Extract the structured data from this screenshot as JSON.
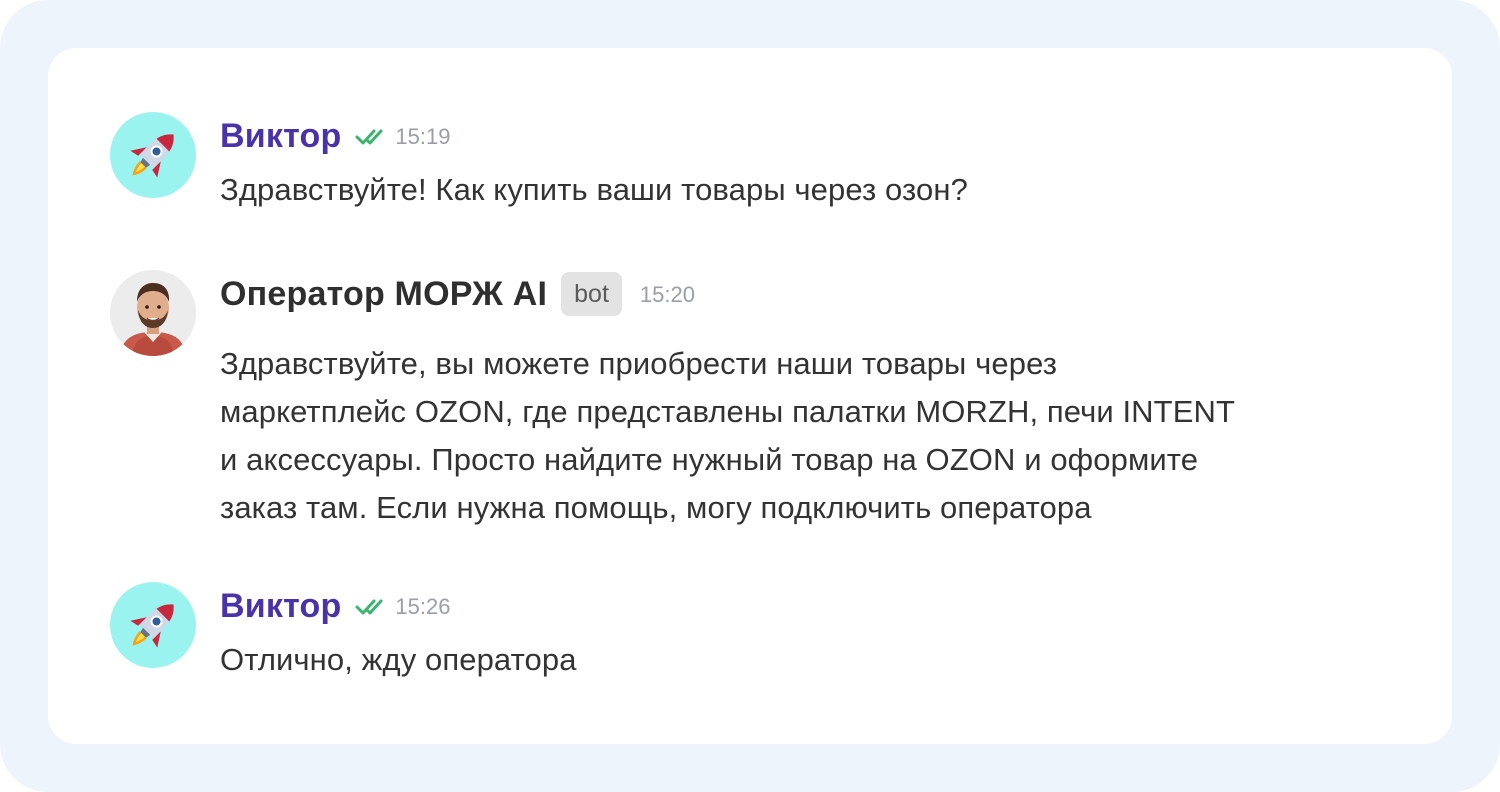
{
  "messages": [
    {
      "author": "Виктор",
      "time": "15:19",
      "text": "Здравствуйте! Как купить ваши товары через озон?",
      "avatar_icon": "rocket-emoji",
      "status_icon": "double-check-icon"
    },
    {
      "author": "Оператор МОРЖ AI",
      "badge": "bot",
      "time": "15:20",
      "text_lines": [
        "Здравствуйте, вы можете приобрести наши товары через",
        "маркетплейс OZON, где представлены палатки MORZH, печи INTENT",
        "и аксессуары. Просто найдите нужный товар на OZON и оформите",
        "заказ там. Если нужна помощь, могу подключить оператора"
      ],
      "avatar_icon": "operator-photo"
    },
    {
      "author": "Виктор",
      "time": "15:26",
      "text": "Отлично, жду оператора",
      "avatar_icon": "rocket-emoji",
      "status_icon": "double-check-icon"
    }
  ],
  "colors": {
    "user_name": "#4a33a9",
    "check": "#3cb46e",
    "outer_bg": "#eef4fc",
    "rocket_avatar_bg": "#9af3ef"
  }
}
